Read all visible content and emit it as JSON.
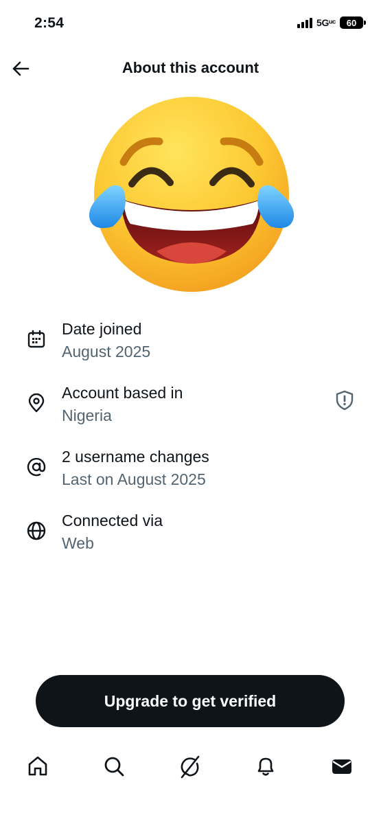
{
  "status_bar": {
    "time": "2:54",
    "network": "5Gᵘᶜ",
    "battery": "60"
  },
  "header": {
    "title": "About this account",
    "back_icon": "arrow-left-icon"
  },
  "avatar": {
    "icon": "face-with-tears-of-joy-emoji"
  },
  "info": [
    {
      "icon": "calendar-icon",
      "title": "Date joined",
      "subtitle": "August 2025"
    },
    {
      "icon": "location-pin-icon",
      "title": "Account based in",
      "subtitle": "Nigeria",
      "action_icon": "shield-alert-icon"
    },
    {
      "icon": "at-sign-icon",
      "title": "2 username changes",
      "subtitle": "Last on August 2025"
    },
    {
      "icon": "globe-icon",
      "title": "Connected via",
      "subtitle": "Web"
    }
  ],
  "upgrade_button": {
    "label": "Upgrade to get verified"
  },
  "bottom_nav": [
    {
      "icon": "home-icon"
    },
    {
      "icon": "search-icon"
    },
    {
      "icon": "grok-icon"
    },
    {
      "icon": "bell-icon"
    },
    {
      "icon": "mail-icon"
    }
  ],
  "colors": {
    "text_primary": "#0f1419",
    "text_secondary": "#536471",
    "button_bg": "#0f1419",
    "background": "#ffffff"
  }
}
